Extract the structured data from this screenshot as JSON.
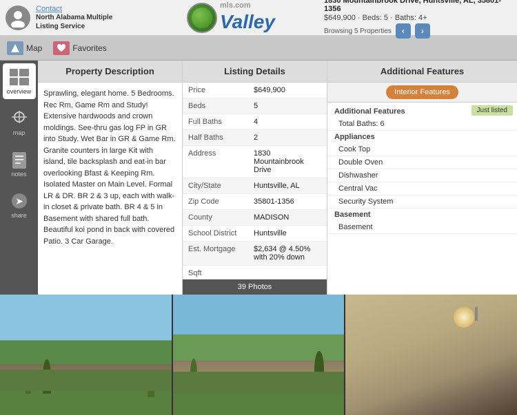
{
  "header": {
    "agent_name": "North Alabama Multiple Listing Service",
    "contact_label": "Contact",
    "logo_text": "Valley",
    "logo_mls": "mls.com",
    "property_address": "1830 Mountainbrook Drive, Huntsville, AL, 35801-1356",
    "property_price": "$649,900 · Beds: 5 · Baths: 4+",
    "browse_text": "Browsing 5 Properties",
    "nav_prev": "‹",
    "nav_next": "›"
  },
  "toolbar": {
    "map_label": "Map",
    "favorites_label": "Favorites"
  },
  "sidebar": {
    "items": [
      {
        "label": "overview",
        "icon": "⊞"
      },
      {
        "label": "map",
        "icon": "📍"
      },
      {
        "label": "notes",
        "icon": "📝"
      },
      {
        "label": "share",
        "icon": "➤"
      }
    ]
  },
  "property_description": {
    "header": "Property Description",
    "body": "Sprawling, elegant home. 5 Bedrooms. Rec Rm, Game Rm and Study! Extensive hardwoods and crown moldings. See-thru gas log FP in GR into Study. Wet Bar in GR & Game Rm. Granite counters in large Kit with island, tile backsplash and eat-in bar overlooking Bfast & Keeping Rm. Isolated Master on Main Level. Formal LR & DR. BR 2 & 3 up, each with walk-in closet & private bath. BR 4 & 5 in Basement with shared full bath. Beautiful koi pond in back with covered Patio. 3 Car Garage."
  },
  "listing_details": {
    "header": "Listing Details",
    "rows": [
      {
        "label": "Price",
        "value": "$649,900"
      },
      {
        "label": "Beds",
        "value": "5"
      },
      {
        "label": "Full Baths",
        "value": "4"
      },
      {
        "label": "Half Baths",
        "value": "2"
      },
      {
        "label": "Address",
        "value": "1830 Mountainbrook Drive"
      },
      {
        "label": "City/State",
        "value": "Huntsville, AL"
      },
      {
        "label": "Zip Code",
        "value": "35801-1356"
      },
      {
        "label": "County",
        "value": "MADISON"
      },
      {
        "label": "School District",
        "value": "Huntsville"
      },
      {
        "label": "Est. Mortgage",
        "value": "$2,634 @ 4.50% with 20% down"
      },
      {
        "label": "Sqft",
        "value": ""
      }
    ],
    "photos_label": "39 Photos"
  },
  "additional_features": {
    "header": "Additional Features",
    "tab_interior": "Interior Features",
    "tab_other": "",
    "just_listed": "Just listed",
    "sections": [
      {
        "type": "section",
        "label": "Additional Features"
      },
      {
        "type": "item",
        "label": "Total Baths: 6"
      },
      {
        "type": "section",
        "label": "Appliances"
      },
      {
        "type": "item",
        "label": "Cook Top"
      },
      {
        "type": "item",
        "label": "Double Oven"
      },
      {
        "type": "item",
        "label": "Dishwasher"
      },
      {
        "type": "item",
        "label": "Central Vac"
      },
      {
        "type": "item",
        "label": "Security System"
      },
      {
        "type": "section",
        "label": "Basement"
      },
      {
        "type": "item",
        "label": "Basement"
      }
    ]
  }
}
